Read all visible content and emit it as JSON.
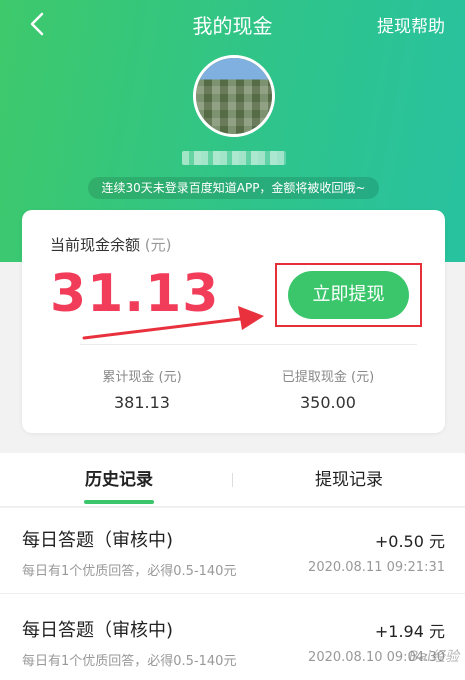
{
  "nav": {
    "title": "我的现金",
    "help_label": "提现帮助"
  },
  "profile": {
    "notice": "连续30天未登录百度知道APP，金额将被收回哦~"
  },
  "balance": {
    "label": "当前现金余额",
    "unit": "(元)",
    "amount": "31.13",
    "withdraw_label": "立即提现"
  },
  "stats": [
    {
      "label": "累计现金 (元)",
      "value": "381.13"
    },
    {
      "label": "已提取现金 (元)",
      "value": "350.00"
    }
  ],
  "tabs": [
    {
      "label": "历史记录",
      "active": true
    },
    {
      "label": "提现记录",
      "active": false
    }
  ],
  "records": [
    {
      "title": "每日答题（审核中)",
      "desc": "每日有1个优质回答，必得0.5-140元",
      "amount": "+0.50 元",
      "time": "2020.08.11 09:21:31"
    },
    {
      "title": "每日答题（审核中)",
      "desc": "每日有1个优质回答，必得0.5-140元",
      "amount": "+1.94 元",
      "time": "2020.08.10 09:04:30"
    }
  ],
  "watermark": "Bai经验",
  "colors": {
    "brand_green": "#3cc66c",
    "amount_red": "#f23d5a",
    "highlight_red": "#e5303a"
  },
  "icons": {
    "back": "chevron-left-icon",
    "annotation": "red-arrow"
  }
}
